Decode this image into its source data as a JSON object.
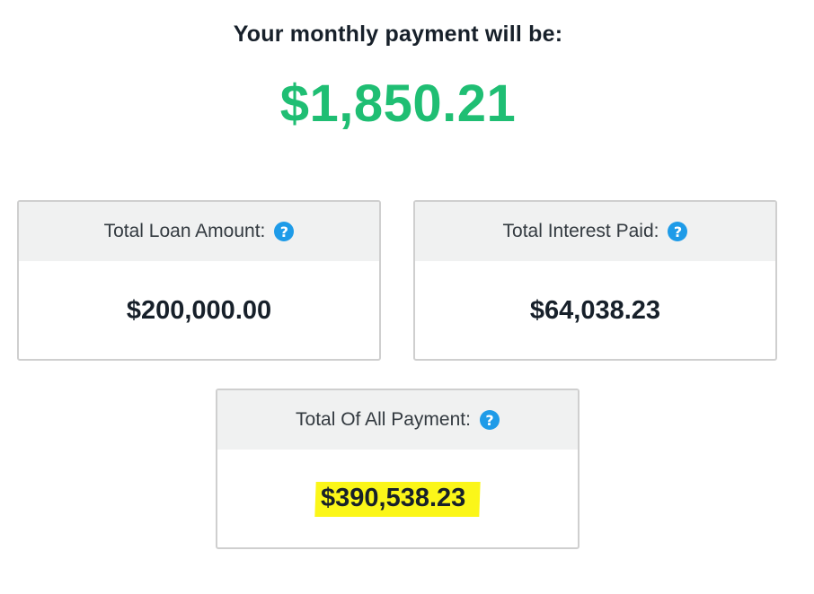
{
  "headline": "Your monthly payment will be:",
  "monthly_payment": "$1,850.21",
  "colors": {
    "payment_green": "#1fbe73",
    "help_icon_blue": "#1e9be8",
    "highlight_yellow": "#fbf619"
  },
  "cards": {
    "loan": {
      "label": "Total Loan Amount:",
      "value": "$200,000.00",
      "icon": "help-icon"
    },
    "interest": {
      "label": "Total Interest Paid:",
      "value": "$64,038.23",
      "icon": "help-icon"
    },
    "total": {
      "label": "Total Of All Payment:",
      "value": "$390,538.23",
      "icon": "help-icon",
      "highlighted": true
    }
  },
  "help_glyph": "?"
}
